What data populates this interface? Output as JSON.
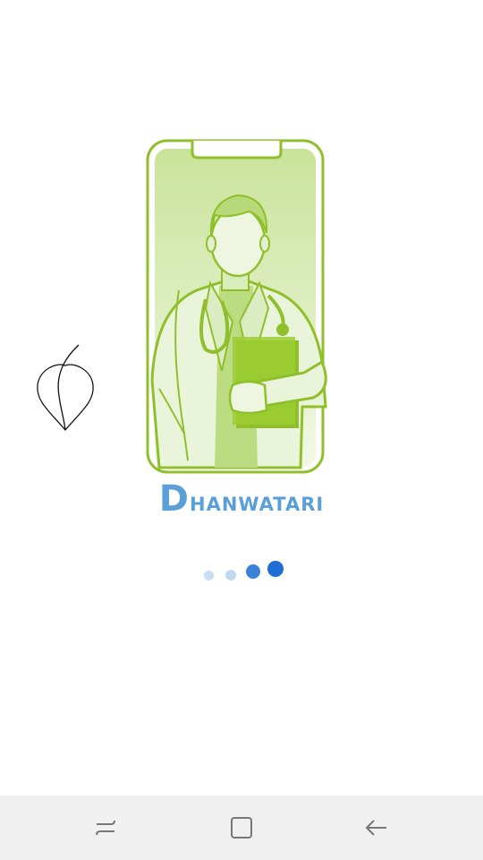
{
  "app": {
    "brand_first_letter": "D",
    "brand_rest": "hanwatari"
  },
  "icons": {
    "leaf": "leaf-logo-icon",
    "illustration": "doctor-in-phone-illustration"
  },
  "loader": {
    "dot_count": 4,
    "active_dots": 2,
    "colors": {
      "inactive": "#c9ddf3",
      "active": "#3b82d6",
      "active_strong": "#1f6fd6"
    }
  },
  "navigation_bar": {
    "recents_icon": "recent-apps-icon",
    "home_icon": "home-square-icon",
    "back_icon": "back-arrow-icon"
  },
  "colors": {
    "brand_text": "#5a9fd8",
    "illustration_green": "#8fc02b",
    "illustration_light": "#e9f3d9",
    "navbar_bg": "#f0f0f0"
  }
}
